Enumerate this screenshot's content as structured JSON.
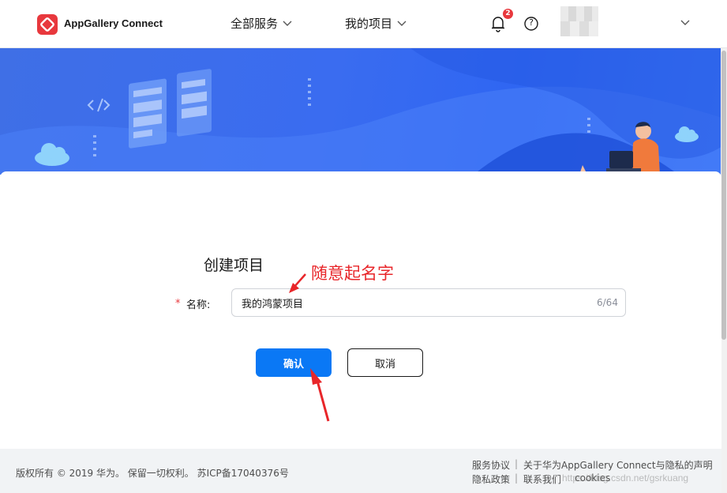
{
  "header": {
    "brand": "AppGallery Connect",
    "nav": [
      {
        "label": "全部服务"
      },
      {
        "label": "我的项目"
      }
    ],
    "notification_count": "2",
    "help_symbol": "?"
  },
  "form": {
    "title": "创建项目",
    "required_mark": "*",
    "name_label": "名称:",
    "name_value": "我的鸿蒙项目",
    "char_count": "6/64",
    "confirm_label": "确认",
    "cancel_label": "取消"
  },
  "annotation": {
    "text": "随意起名字",
    "color": "#e8262a"
  },
  "footer": {
    "copyright": "版权所有 © 2019 华为。 保留一切权利。 苏ICP备17040376号",
    "links": [
      {
        "label": "服务协议"
      },
      {
        "label": "关于华为AppGallery Connect与隐私的声明"
      },
      {
        "label": "隐私政策"
      },
      {
        "label": "联系我们"
      },
      {
        "label": "cookies"
      }
    ],
    "watermark": "https://blog.csdn.net/gsrkuang"
  },
  "colors": {
    "brand_red": "#e8383d",
    "primary_blue": "#0a78f5",
    "banner_blue": "#3a6cf0"
  },
  "icons": [
    "appgallery-logo-icon",
    "chevron-down-icon",
    "bell-icon",
    "help-circle-icon",
    "cloud-icon",
    "code-icon",
    "person-laptop-illustration-icon"
  ]
}
